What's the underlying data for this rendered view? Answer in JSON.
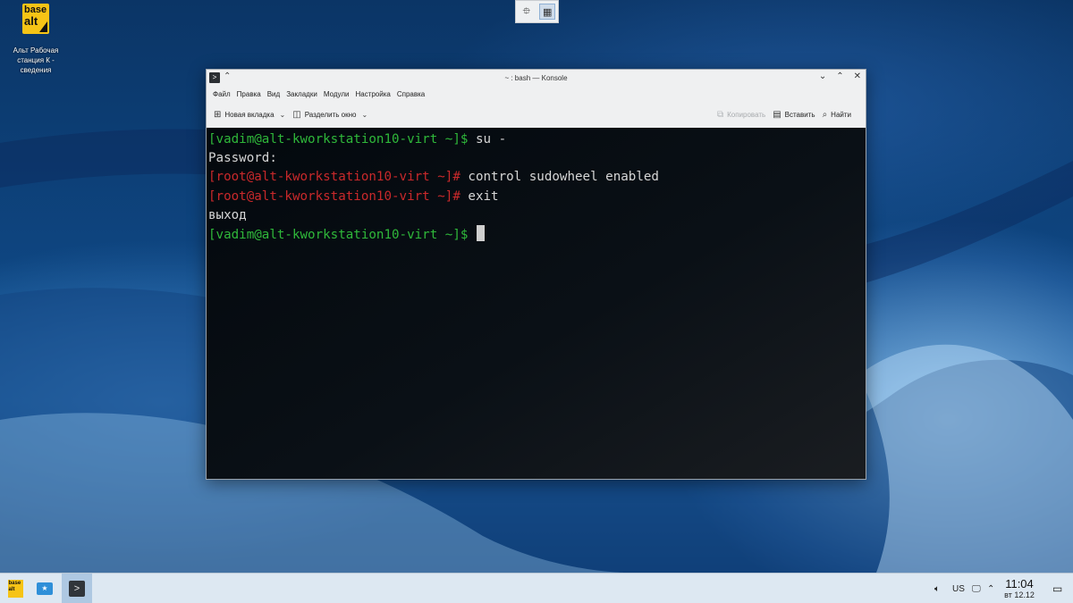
{
  "desktop": {
    "icon": {
      "logo_line1": "base",
      "logo_line2": "alt",
      "label": "Альт Рабочая станция К - сведения"
    }
  },
  "window": {
    "title": "~ : bash — Konsole",
    "menu": [
      "Файл",
      "Правка",
      "Вид",
      "Закладки",
      "Модули",
      "Настройка",
      "Справка"
    ],
    "toolbar": {
      "new_tab": "Новая вкладка",
      "split_view": "Разделить окно",
      "copy": "Копировать",
      "paste": "Вставить",
      "find": "Найти"
    },
    "terminal": [
      {
        "prompt": "[vadim@alt-kworkstation10-virt ~]$",
        "prompt_color": "#2fb83a",
        "command": " su -"
      },
      {
        "prompt": "",
        "prompt_color": "",
        "command": "Password:"
      },
      {
        "prompt": "[root@alt-kworkstation10-virt ~]#",
        "prompt_color": "#c9292b",
        "command": " control sudowheel enabled"
      },
      {
        "prompt": "[root@alt-kworkstation10-virt ~]#",
        "prompt_color": "#c9292b",
        "command": " exit"
      },
      {
        "prompt": "",
        "prompt_color": "",
        "command": "выход"
      },
      {
        "prompt": "[vadim@alt-kworkstation10-virt ~]$",
        "prompt_color": "#2fb83a",
        "command": " "
      }
    ]
  },
  "taskbar": {
    "layout": "US",
    "time": "11:04",
    "date": "вт 12.12"
  }
}
